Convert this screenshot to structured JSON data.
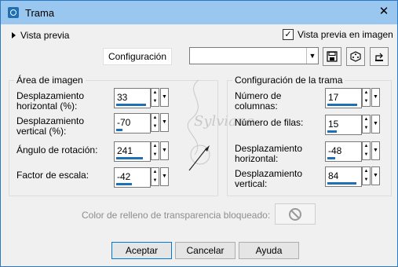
{
  "window": {
    "title": "Trama",
    "close_glyph": "✕"
  },
  "top": {
    "preview_label": "Vista previa",
    "preview_in_image_label": "Vista previa en imagen",
    "preview_in_image_checked": true
  },
  "config": {
    "button_label": "Configuración",
    "combo_value": "",
    "icons": [
      "save-icon",
      "dice-icon",
      "reset-icon"
    ]
  },
  "image_area": {
    "legend": "Área de imagen",
    "h_offset": {
      "label_l1": "Desplazamiento",
      "label_l2": "horizontal (%):",
      "value": "33",
      "fill": 0.95
    },
    "v_offset": {
      "label_l1": "Desplazamiento",
      "label_l2": "vertical (%):",
      "value": "-70",
      "fill": 0.2
    },
    "rotation": {
      "label": "Ángulo de rotación:",
      "value": "241",
      "fill": 0.85
    },
    "scale": {
      "label": "Factor de escala:",
      "value": "-42",
      "fill": 0.5
    }
  },
  "tile_config": {
    "legend": "Configuración de la trama",
    "columns": {
      "label_l1": "Número de",
      "label_l2": "columnas:",
      "value": "17",
      "fill": 0.95
    },
    "rows": {
      "label": "Número de filas:",
      "value": "15",
      "fill": 0.3
    },
    "h_offset": {
      "label_l1": "Desplazamiento",
      "label_l2": "horizontal:",
      "value": "-48",
      "fill": 0.25
    },
    "v_offset": {
      "label_l1": "Desplazamiento",
      "label_l2": "vertical:",
      "value": "84",
      "fill": 0.92
    }
  },
  "lock": {
    "label": "Color de relleno de transparencia bloqueado:",
    "icon": "no-entry-icon"
  },
  "watermark": {
    "text": "Sylviane"
  },
  "buttons": {
    "accept": "Aceptar",
    "cancel": "Cancelar",
    "help": "Ayuda"
  }
}
